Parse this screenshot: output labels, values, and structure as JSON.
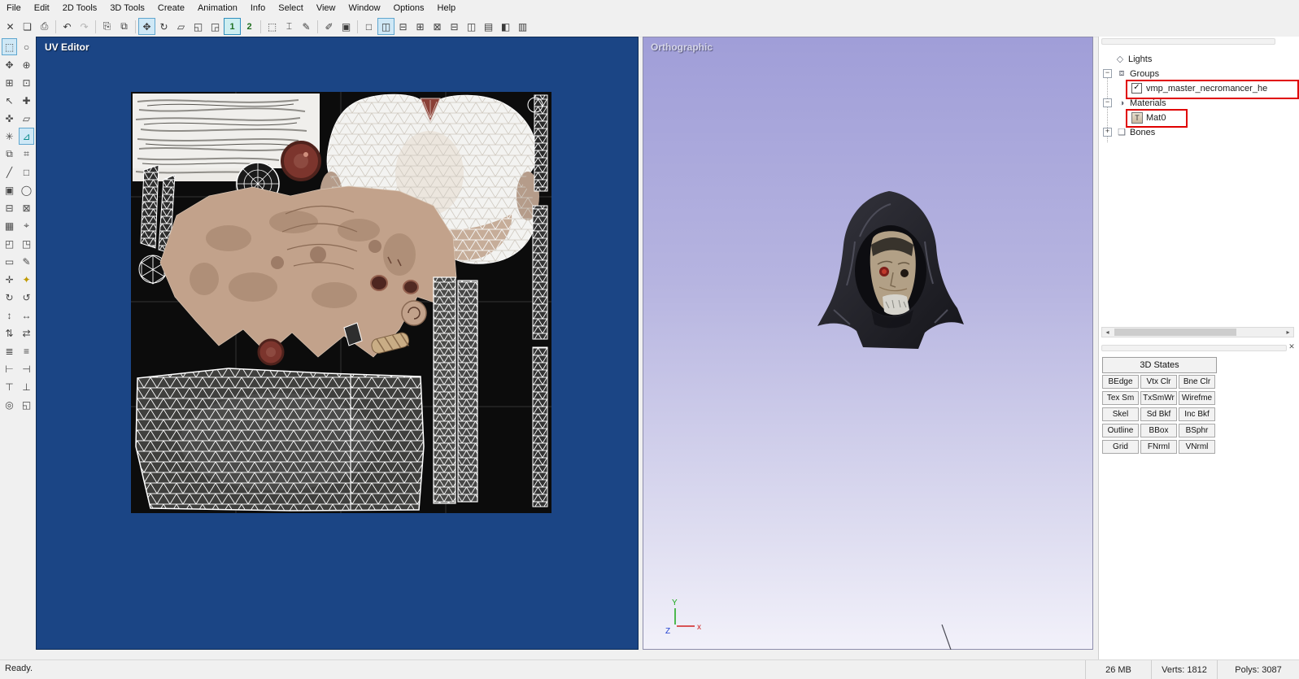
{
  "menu": {
    "items": [
      "File",
      "Edit",
      "2D Tools",
      "3D Tools",
      "Create",
      "Animation",
      "Info",
      "Select",
      "View",
      "Window",
      "Options",
      "Help"
    ]
  },
  "toolbar": {
    "delete": "✕",
    "open": "❏",
    "save": "⎙",
    "undo": "↶",
    "redo": "↷",
    "copy": "⎘",
    "paste": "⧉",
    "move": "✥",
    "rotate": "↻",
    "scale": "▱",
    "transform_box": "◱",
    "transform_arrow": "◲",
    "page1": "1",
    "page2": "2",
    "select_rect": "⬚",
    "select_item": "⌶",
    "select_pen": "✎",
    "eyedropper": "✐",
    "lock": "▣",
    "layouts": [
      "□",
      "◫",
      "⊟",
      "⊞",
      "⊠",
      "⊟",
      "◫",
      "▤",
      "◧",
      "▥"
    ]
  },
  "palette": {
    "items": [
      {
        "name": "select-rect",
        "glyph": "⬚"
      },
      {
        "name": "select-lasso",
        "glyph": "○"
      },
      {
        "name": "pan",
        "glyph": "✥"
      },
      {
        "name": "zoom",
        "glyph": "⊕"
      },
      {
        "name": "zoom-region",
        "glyph": "⊞"
      },
      {
        "name": "magic-select",
        "glyph": "⊡"
      },
      {
        "name": "pick",
        "glyph": "↖"
      },
      {
        "name": "weld",
        "glyph": "✚"
      },
      {
        "name": "move-points",
        "glyph": "✜"
      },
      {
        "name": "skew",
        "glyph": "▱"
      },
      {
        "name": "snap",
        "glyph": "✳"
      },
      {
        "name": "measure",
        "glyph": "⊿"
      },
      {
        "name": "duplicate",
        "glyph": "⧉"
      },
      {
        "name": "grid",
        "glyph": "⌗"
      },
      {
        "name": "line",
        "glyph": "╱"
      },
      {
        "name": "rectangle",
        "glyph": "□"
      },
      {
        "name": "stack",
        "glyph": "▣"
      },
      {
        "name": "ellipse",
        "glyph": "◯"
      },
      {
        "name": "pack",
        "glyph": "⊟"
      },
      {
        "name": "box-map",
        "glyph": "⊠"
      },
      {
        "name": "fill",
        "glyph": "▦"
      },
      {
        "name": "target",
        "glyph": "⌖"
      },
      {
        "name": "split-h",
        "glyph": "◰"
      },
      {
        "name": "split-v",
        "glyph": "◳"
      },
      {
        "name": "eraser",
        "glyph": "▭"
      },
      {
        "name": "pencil",
        "glyph": "✎"
      },
      {
        "name": "pin",
        "glyph": "✛"
      },
      {
        "name": "pushpin",
        "glyph": "✦"
      },
      {
        "name": "rotate-cw",
        "glyph": "↻"
      },
      {
        "name": "rotate-ccw",
        "glyph": "↺"
      },
      {
        "name": "stretch-v",
        "glyph": "↕"
      },
      {
        "name": "stretch-h",
        "glyph": "↔"
      },
      {
        "name": "sort",
        "glyph": "⇅"
      },
      {
        "name": "swap",
        "glyph": "⇄"
      },
      {
        "name": "distribute-h",
        "glyph": "≣"
      },
      {
        "name": "distribute-v",
        "glyph": "≡"
      },
      {
        "name": "align-left",
        "glyph": "⊢"
      },
      {
        "name": "align-right",
        "glyph": "⊣"
      },
      {
        "name": "align-top",
        "glyph": "⊤"
      },
      {
        "name": "align-bottom",
        "glyph": "⊥"
      },
      {
        "name": "center",
        "glyph": "◎"
      },
      {
        "name": "fit",
        "glyph": "◱"
      }
    ]
  },
  "uv_editor": {
    "title": "UV Editor"
  },
  "viewport": {
    "title": "Orthographic",
    "axis_x": "x",
    "axis_y": "Y",
    "axis_z": "Z"
  },
  "scene_tree": {
    "lights": "Lights",
    "groups": "Groups",
    "group_item": "vmp_master_necromancer_he",
    "materials": "Materials",
    "material_item": "Mat0",
    "bones": "Bones",
    "icons": {
      "lights": "◇",
      "groups": "⧈",
      "materials": "◑",
      "bones": "❑",
      "check": "✓",
      "open": "−",
      "closed": "+",
      "material_thumb": "T",
      "scroll_left": "◂",
      "scroll_right": "▸",
      "close": "✕"
    }
  },
  "states": {
    "header": "3D States",
    "buttons": [
      "BEdge",
      "Vtx Clr",
      "Bne Clr",
      "Tex Sm",
      "TxSmWr",
      "Wirefme",
      "Skel",
      "Sd Bkf",
      "Inc Bkf",
      "Outline",
      "BBox",
      "BSphr",
      "Grid",
      "FNrml",
      "VNrml"
    ]
  },
  "status": {
    "ready": "Ready.",
    "memory": "26 MB",
    "verts": "Verts: 1812",
    "polys": "Polys: 3087"
  },
  "colors": {
    "uv_background": "#1b4585",
    "viewport_top": "#a09ed8",
    "viewport_bottom": "#f2f1fa",
    "annotation_red": "#e00000",
    "selection_highlight": "#cfe8f6"
  }
}
